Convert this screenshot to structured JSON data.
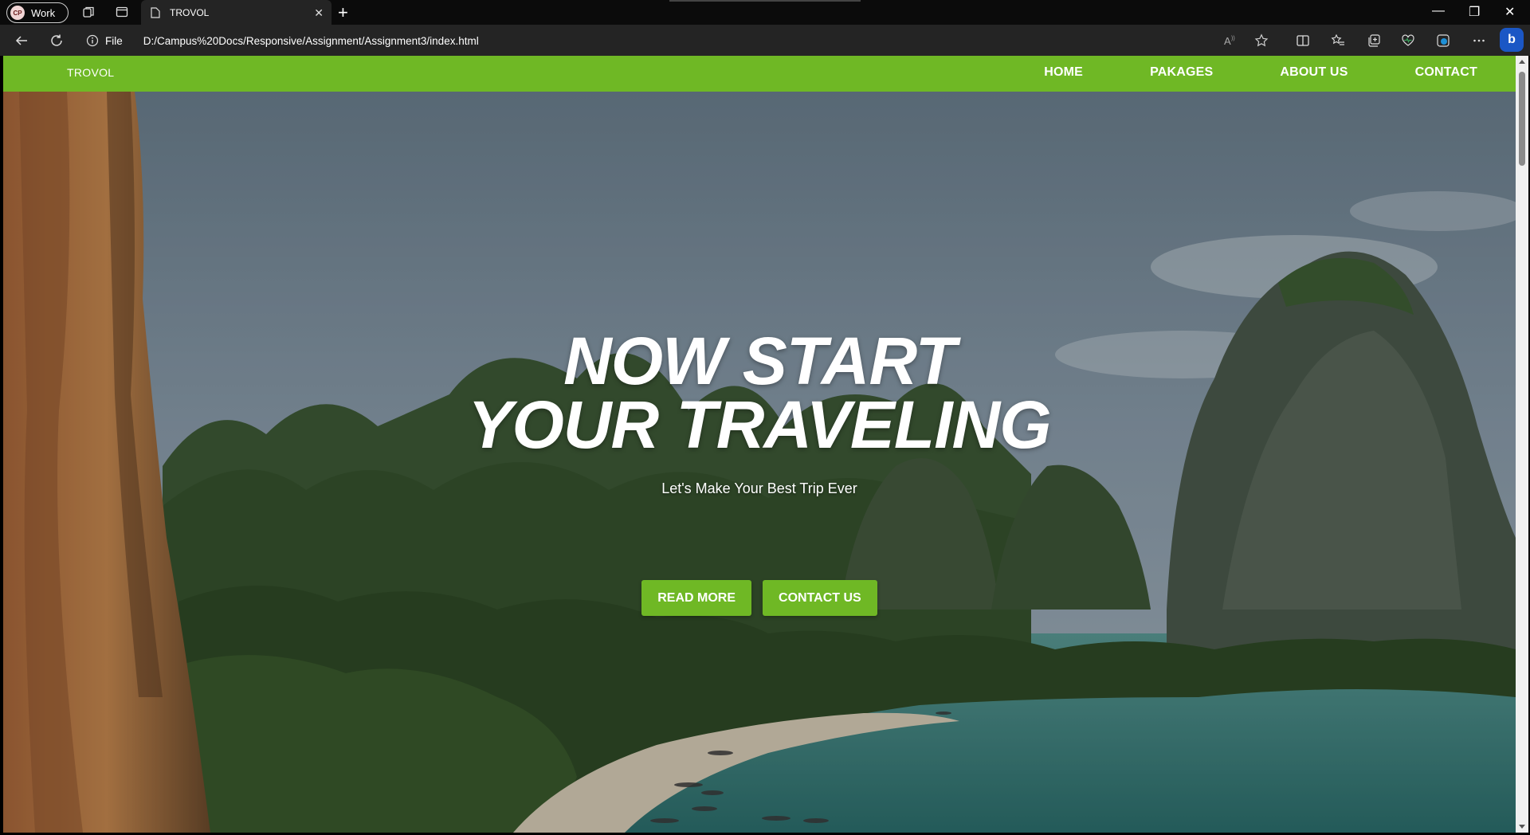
{
  "browser": {
    "profile": {
      "initials": "CP",
      "name": "Work"
    },
    "tab": {
      "title": "TROVOL"
    },
    "address": {
      "scheme_label": "File",
      "url": "D:/Campus%20Docs/Responsive/Assignment/Assignment3/index.html"
    }
  },
  "site": {
    "brand": "TROVOL",
    "menu": [
      "HOME",
      "PAKAGES",
      "ABOUT US",
      "CONTACT"
    ],
    "hero": {
      "headline_line1": "NOW START",
      "headline_line2": "YOUR TRAVELING",
      "subtitle": "Let's Make Your Best Trip Ever",
      "buttons": [
        "READ MORE",
        "CONTACT US"
      ]
    },
    "colors": {
      "accent": "#6fb825"
    }
  }
}
